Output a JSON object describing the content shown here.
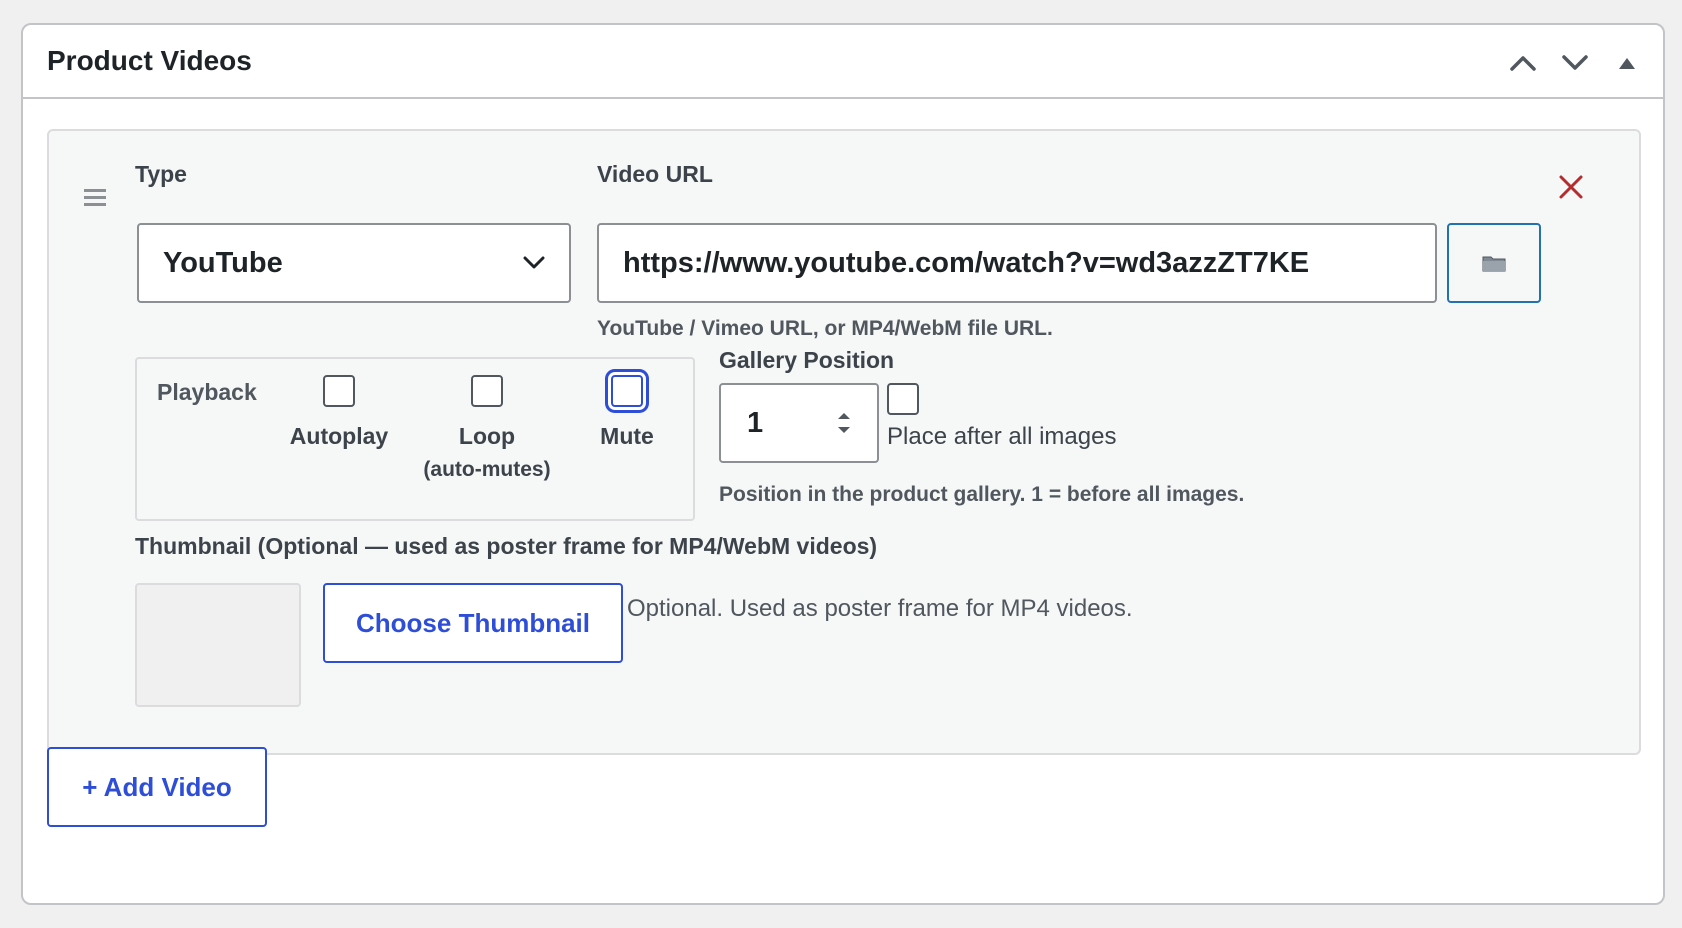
{
  "metabox": {
    "title": "Product Videos",
    "controls": {
      "move_up_icon": "chevron-up-icon",
      "move_down_icon": "chevron-down-icon",
      "toggle_icon": "triangle-up-icon"
    }
  },
  "video_item": {
    "drag_icon": "drag-handle-icon",
    "remove_icon": "close-icon",
    "type": {
      "label": "Type",
      "value": "YouTube"
    },
    "video_url": {
      "label": "Video URL",
      "value": "https://www.youtube.com/watch?v=wd3azzZT7KE",
      "help": "YouTube / Vimeo URL, or MP4/WebM file URL.",
      "media_button_icon": "folder-icon"
    },
    "playback": {
      "label": "Playback",
      "options": [
        {
          "label": "Autoplay",
          "sub": "",
          "checked": false
        },
        {
          "label": "Loop",
          "sub": "(auto-mutes)",
          "checked": false
        },
        {
          "label": "Mute",
          "sub": "",
          "checked": false,
          "focused": true
        }
      ]
    },
    "gallery_position": {
      "label": "Gallery Position",
      "value": "1",
      "place_after_label": "Place after all images",
      "place_after_checked": false,
      "help": "Position in the product gallery. 1 = before all images."
    },
    "thumbnail": {
      "label": "Thumbnail (Optional — used as poster frame for MP4/WebM videos)",
      "button_label": "Choose Thumbnail",
      "note": "Optional. Used as poster frame for MP4 videos."
    }
  },
  "add_video_label": "+ Add Video",
  "colors": {
    "accent": "#2e4ed8",
    "remove": "#b32d2e",
    "border": "#c3c4c7"
  }
}
